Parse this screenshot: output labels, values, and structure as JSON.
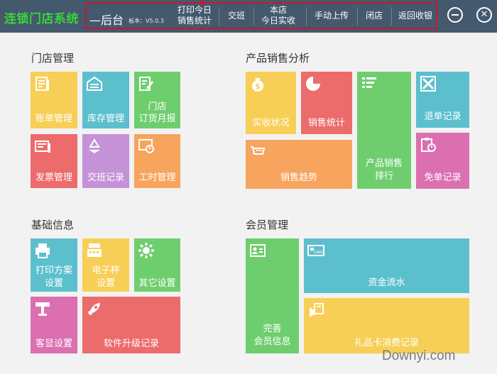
{
  "app": {
    "title": "连锁门店系统",
    "subtitle": "—后台",
    "version": "板本：V5.0.3"
  },
  "nav": {
    "print_sales": [
      "打印今日",
      "销售统计"
    ],
    "handover": "交班",
    "store_today": [
      "本店",
      "今日实收"
    ],
    "manual_upload": "手动上传",
    "close_store": "闭店",
    "back_to_pos": "返回收银"
  },
  "window_controls": {
    "minimize": "minus-icon",
    "close": "x-icon"
  },
  "sections": {
    "store": {
      "title": "门店管理",
      "tiles": [
        {
          "label": "账单管理",
          "icon": "document-icon",
          "color": "#f7cf57"
        },
        {
          "label": "库存管理",
          "icon": "warehouse-icon",
          "color": "#5cbfcd"
        },
        {
          "label": [
            "门店",
            "订货月报"
          ],
          "icon": "edit-icon",
          "color": "#6ece6e"
        },
        {
          "label": "发票管理",
          "icon": "invoice-icon",
          "color": "#ec6b6b"
        },
        {
          "label": "交班记录",
          "icon": "recycle-icon",
          "color": "#c592d8"
        },
        {
          "label": "工时管理",
          "icon": "clock-board-icon",
          "color": "#f7a45e"
        }
      ]
    },
    "sales": {
      "title": "产品销售分析",
      "tiles": [
        {
          "label": "实收状况",
          "icon": "money-bag-icon",
          "color": "#f7cf57"
        },
        {
          "label": "销售统计",
          "icon": "pie-chart-icon",
          "color": "#ec6b6b"
        },
        {
          "label": [
            "产品销售",
            "排行"
          ],
          "icon": "list-icon",
          "color": "#6ece6e"
        },
        {
          "label": "退单记录",
          "icon": "cancel-icon",
          "color": "#5cbfcd"
        },
        {
          "label": "销售趋势",
          "icon": "cart-icon",
          "color": "#f7a45e"
        },
        {
          "label": "免单记录",
          "icon": "clipboard-clock-icon",
          "color": "#db6fb0"
        }
      ]
    },
    "basic": {
      "title": "基础信息",
      "tiles": [
        {
          "label": [
            "打印方案",
            "设置"
          ],
          "icon": "printer-icon",
          "color": "#5cbfcd"
        },
        {
          "label": [
            "电子秤",
            "设置"
          ],
          "icon": "scale-icon",
          "color": "#f7cf57"
        },
        {
          "label": "其它设置",
          "icon": "gear-icon",
          "color": "#6ece6e"
        },
        {
          "label": "客显设置",
          "icon": "display-icon",
          "color": "#db6fb0"
        },
        {
          "label": "软件升级记录",
          "icon": "rocket-icon",
          "color": "#ec6b6b"
        }
      ]
    },
    "member": {
      "title": "会员管理",
      "tiles": [
        {
          "label": [
            "完善",
            "会员信息"
          ],
          "icon": "id-card-icon",
          "color": "#6ece6e"
        },
        {
          "label": "资金流水",
          "icon": "card-icon",
          "color": "#5cbfcd"
        },
        {
          "label": "礼品卡消费记录",
          "icon": "hand-card-icon",
          "color": "#f7cf57"
        }
      ]
    }
  },
  "watermark": "Downyi.com"
}
